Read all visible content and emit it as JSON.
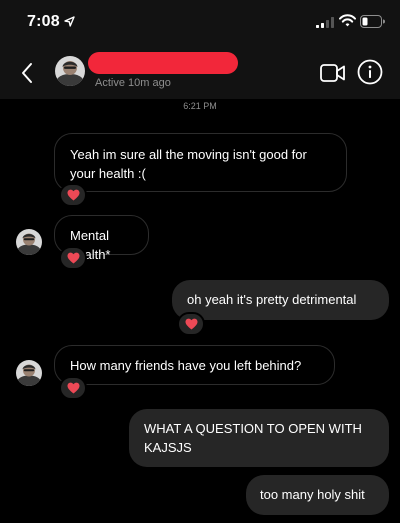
{
  "status_bar": {
    "time": "7:08",
    "icons": [
      "location-arrow-icon",
      "cellular-signal-icon",
      "wifi-icon",
      "battery-icon"
    ]
  },
  "header": {
    "contact_name": "",
    "active_status": "Active 10m ago",
    "icons": [
      "back-chevron-icon",
      "video-call-icon",
      "info-icon"
    ]
  },
  "thread": {
    "timestamp": "6:21 PM",
    "messages": [
      {
        "side": "received",
        "text": "Yeah im sure all the moving isn't good for your health :(",
        "reaction": "heart"
      },
      {
        "side": "received",
        "text": "Mental health*",
        "reaction": "heart"
      },
      {
        "side": "sent",
        "text": "oh yeah it's pretty detrimental",
        "reaction": "heart"
      },
      {
        "side": "received",
        "text": "How many friends have you left behind?",
        "reaction": "heart"
      },
      {
        "side": "sent",
        "text": "WHAT A QUESTION TO OPEN WITH KAJSJS"
      },
      {
        "side": "sent",
        "text": "too many holy shit"
      }
    ]
  },
  "colors": {
    "header_bg": "#121212",
    "sent_bubble": "#262626",
    "received_border": "#2c2c2c",
    "heart": "#ed4956",
    "redaction": "#f2273a",
    "muted_text": "#8e8e8e"
  }
}
